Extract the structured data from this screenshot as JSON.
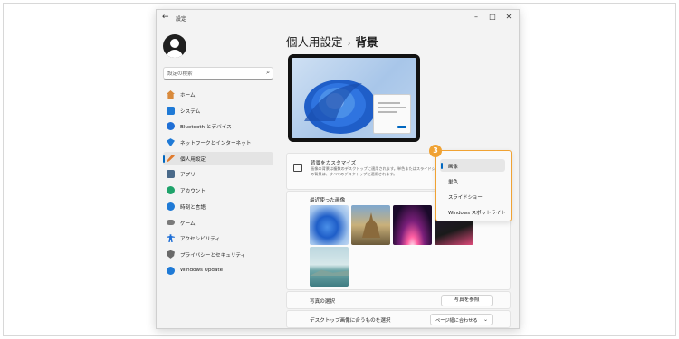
{
  "window": {
    "title": "設定",
    "back_icon": "back-arrow-icon",
    "controls": [
      "minimize-icon",
      "maximize-icon",
      "close-icon"
    ]
  },
  "sidebar": {
    "search_placeholder": "設定の検索",
    "items": [
      {
        "label": "ホーム",
        "icon": "home-icon",
        "color": "#d98a3c"
      },
      {
        "label": "システム",
        "icon": "system-icon",
        "color": "#1f7ad6"
      },
      {
        "label": "Bluetooth とデバイス",
        "icon": "bluetooth-icon",
        "color": "#1f6fd6"
      },
      {
        "label": "ネットワークとインターネット",
        "icon": "network-icon",
        "color": "#1f7ad6"
      },
      {
        "label": "個人用設定",
        "icon": "brush-icon",
        "color": "#e07a2c"
      },
      {
        "label": "アプリ",
        "icon": "apps-icon",
        "color": "#4a6a8a"
      },
      {
        "label": "アカウント",
        "icon": "account-icon",
        "color": "#1fa36b"
      },
      {
        "label": "時刻と言語",
        "icon": "time-language-icon",
        "color": "#1f7ad6"
      },
      {
        "label": "ゲーム",
        "icon": "gaming-icon",
        "color": "#7a7a7a"
      },
      {
        "label": "アクセシビリティ",
        "icon": "accessibility-icon",
        "color": "#1f6fd6"
      },
      {
        "label": "プライバシーとセキュリティ",
        "icon": "shield-icon",
        "color": "#6a6a6a"
      },
      {
        "label": "Windows Update",
        "icon": "windows-update-icon",
        "color": "#1f7ad6"
      }
    ],
    "active_index": 4
  },
  "main": {
    "breadcrumb_parent": "個人用設定",
    "breadcrumb_sep": "›",
    "breadcrumb_current": "背景",
    "customize": {
      "title": "背景をカスタマイズ",
      "description": "画像の背景は複数のデスクトップに適用されます。単色またはスライドショーの背景は、すべてのデスクトップに適用されます。"
    },
    "recent_images_label": "最近使った画像",
    "photo_select_label": "写真の選択",
    "browse_button": "写真を参照",
    "fit_label": "デスクトップ画像に合うものを選択",
    "fit_value": "ページ幅に合わせる"
  },
  "dropdown": {
    "options": [
      "画像",
      "単色",
      "スライドショー",
      "Windows スポットライト"
    ],
    "selected_index": 0
  },
  "callout": {
    "number": "3",
    "color": "#f0a233"
  }
}
